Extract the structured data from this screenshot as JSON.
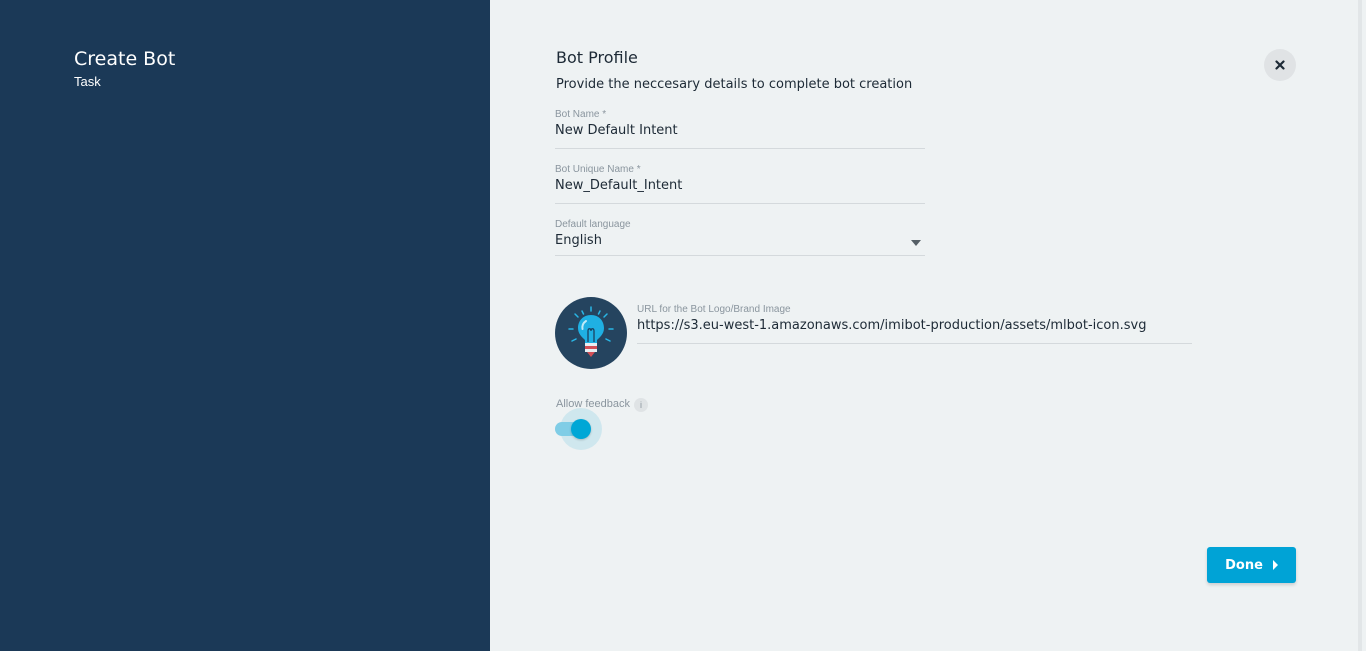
{
  "sidebar": {
    "title": "Create Bot",
    "subtitle": "Task"
  },
  "profile": {
    "title": "Bot Profile",
    "description": "Provide the neccesary details to complete bot creation"
  },
  "fields": {
    "bot_name": {
      "label": "Bot Name *",
      "value": "New Default Intent"
    },
    "bot_unique_name": {
      "label": "Bot Unique Name *",
      "value": "New_Default_Intent"
    },
    "default_language": {
      "label": "Default language",
      "value": "English"
    },
    "logo_url": {
      "label": "URL for the Bot Logo/Brand Image",
      "value": "https://s3.eu-west-1.amazonaws.com/imibot-production/assets/mlbot-icon.svg"
    }
  },
  "feedback": {
    "label": "Allow feedback",
    "info_glyph": "i",
    "enabled": true
  },
  "actions": {
    "done_label": "Done"
  },
  "icons": {
    "close": "close-icon",
    "info": "info-icon",
    "logo": "lightbulb-logo-icon",
    "dropdown": "caret-down-icon",
    "done_arrow": "caret-right-icon"
  },
  "colors": {
    "sidebar_bg": "#1b3957",
    "content_bg": "#eef2f3",
    "accent": "#00a3d6",
    "logo_bg": "#25445f"
  }
}
